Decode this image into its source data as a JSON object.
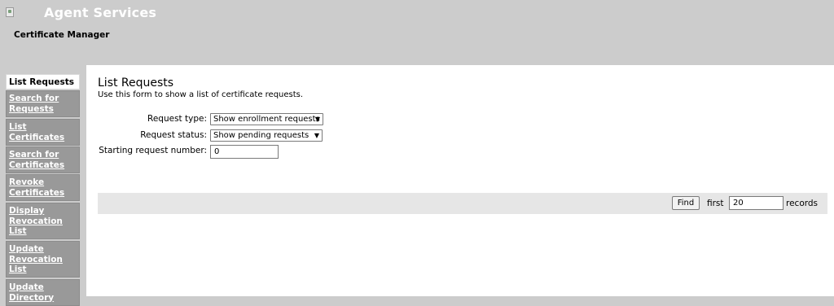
{
  "header": {
    "title": "Agent Services",
    "subtitle": "Certificate Manager"
  },
  "sidebar": {
    "items": [
      {
        "label": "List Requests",
        "active": true
      },
      {
        "label": "Search for Requests"
      },
      {
        "label": "List Certificates"
      },
      {
        "label": "Search for Certificates"
      },
      {
        "label": "Revoke Certificates"
      },
      {
        "label": "Display Revocation List"
      },
      {
        "label": "Update Revocation List"
      },
      {
        "label": "Update Directory"
      }
    ]
  },
  "main": {
    "title": "List Requests",
    "description": "Use this form to show a list of certificate requests.",
    "form": {
      "request_type_label": "Request type:",
      "request_type_value": "Show enrollment requests",
      "request_status_label": "Request status:",
      "request_status_value": "Show pending requests",
      "start_label": "Starting request number:",
      "start_value": "0"
    },
    "footer": {
      "find_label": "Find",
      "first_label": "first",
      "count_value": "20",
      "records_label": "records"
    }
  }
}
